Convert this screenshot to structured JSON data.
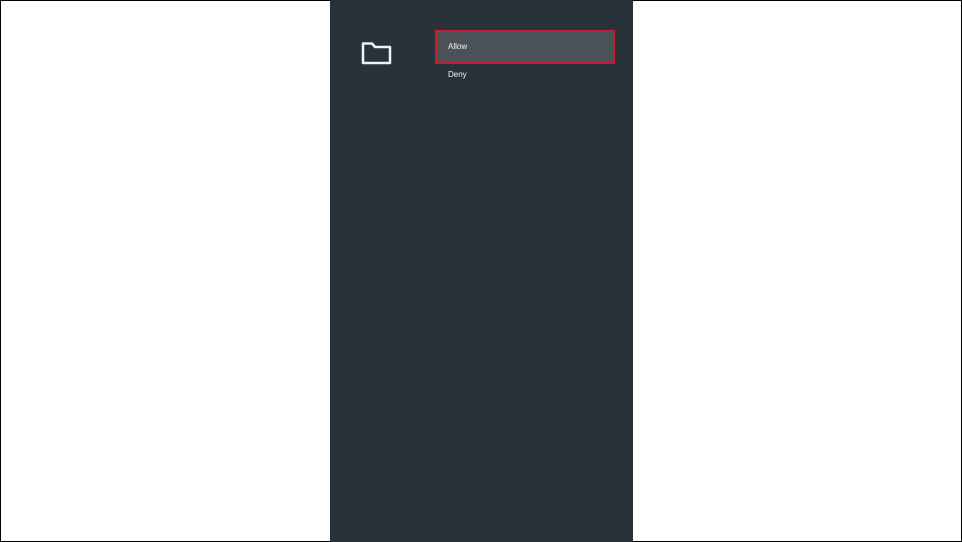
{
  "dialog": {
    "icon": "folder-icon",
    "options": [
      {
        "label": "Allow",
        "selected": true
      },
      {
        "label": "Deny",
        "selected": false
      }
    ]
  },
  "colors": {
    "panel_background": "#283238",
    "selected_background": "#4b5257",
    "focus_border": "#c3202b",
    "text": "#f2f4f5"
  }
}
